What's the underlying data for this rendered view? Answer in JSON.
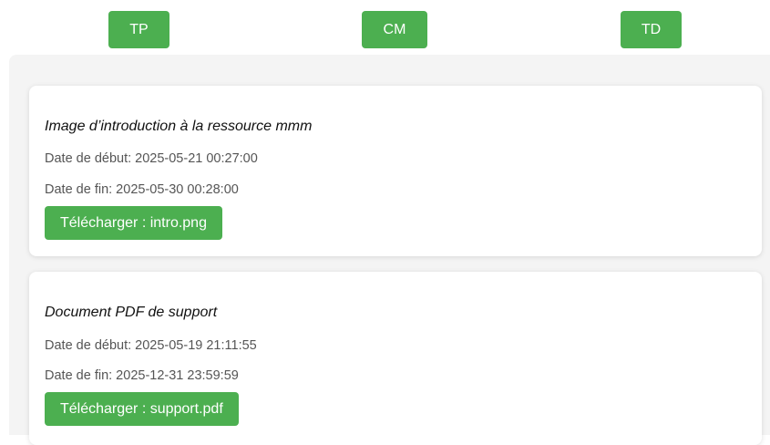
{
  "tabs": [
    {
      "label": "TP"
    },
    {
      "label": "CM"
    },
    {
      "label": "TD"
    }
  ],
  "resources": [
    {
      "title": "Image d’introduction à la ressource mmm",
      "start": "Date de début: 2025-05-21 00:27:00",
      "end": "Date de fin: 2025-05-30 00:28:00",
      "download_label": "Télécharger : intro.png"
    },
    {
      "title": "Document PDF de support",
      "start": "Date de début: 2025-05-19 21:11:55",
      "end": "Date de fin: 2025-12-31 23:59:59",
      "download_label": "Télécharger : support.pdf"
    }
  ],
  "colors": {
    "accent": "#4caf50",
    "panel_bg": "#f4f4f4",
    "card_bg": "#ffffff",
    "meta_text": "#555555"
  }
}
